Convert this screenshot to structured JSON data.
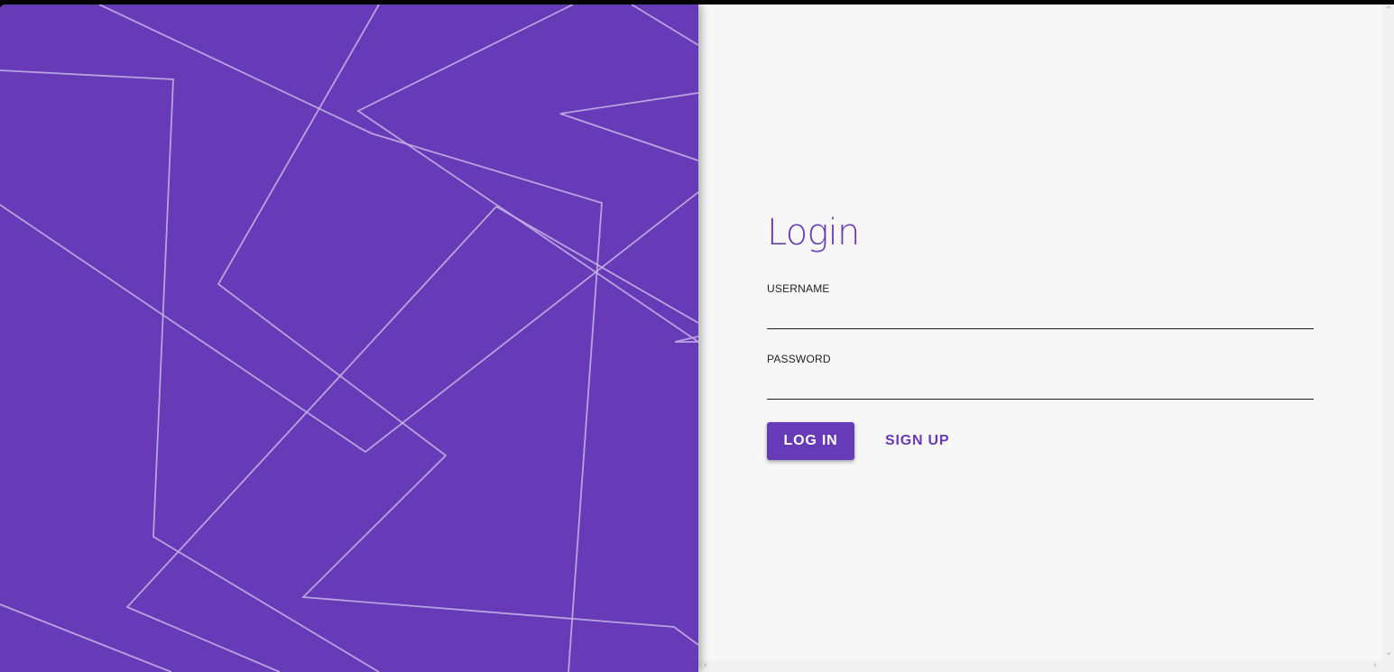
{
  "colors": {
    "brand": "#673ab7",
    "panel_bg": "#f7f7f7",
    "line": "#c7b5e6"
  },
  "login": {
    "title": "Login",
    "username_label": "USERNAME",
    "username_value": "",
    "password_label": "PASSWORD",
    "password_value": "",
    "login_button": "LOG IN",
    "signup_button": "SIGN UP"
  },
  "scrollbars": {
    "up_icon": "chevron-up-icon",
    "down_icon": "chevron-down-icon",
    "left_icon": "chevron-left-icon",
    "right_icon": "chevron-right-icon"
  }
}
